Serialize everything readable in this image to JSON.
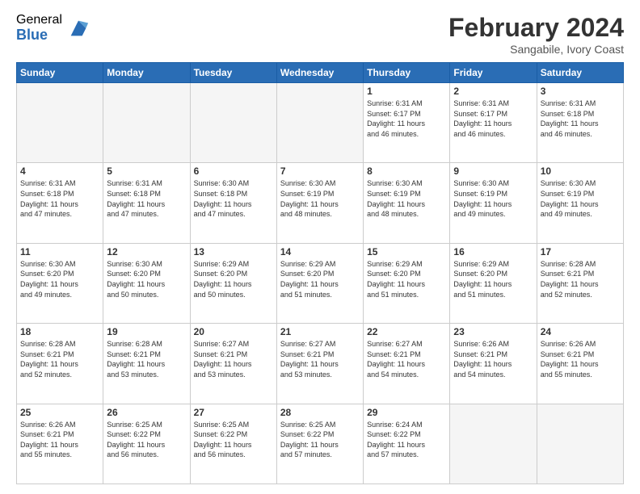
{
  "logo": {
    "general": "General",
    "blue": "Blue"
  },
  "title": {
    "month_year": "February 2024",
    "location": "Sangabile, Ivory Coast"
  },
  "days_of_week": [
    "Sunday",
    "Monday",
    "Tuesday",
    "Wednesday",
    "Thursday",
    "Friday",
    "Saturday"
  ],
  "weeks": [
    [
      {
        "day": "",
        "info": ""
      },
      {
        "day": "",
        "info": ""
      },
      {
        "day": "",
        "info": ""
      },
      {
        "day": "",
        "info": ""
      },
      {
        "day": "1",
        "info": "Sunrise: 6:31 AM\nSunset: 6:17 PM\nDaylight: 11 hours\nand 46 minutes."
      },
      {
        "day": "2",
        "info": "Sunrise: 6:31 AM\nSunset: 6:17 PM\nDaylight: 11 hours\nand 46 minutes."
      },
      {
        "day": "3",
        "info": "Sunrise: 6:31 AM\nSunset: 6:18 PM\nDaylight: 11 hours\nand 46 minutes."
      }
    ],
    [
      {
        "day": "4",
        "info": "Sunrise: 6:31 AM\nSunset: 6:18 PM\nDaylight: 11 hours\nand 47 minutes."
      },
      {
        "day": "5",
        "info": "Sunrise: 6:31 AM\nSunset: 6:18 PM\nDaylight: 11 hours\nand 47 minutes."
      },
      {
        "day": "6",
        "info": "Sunrise: 6:30 AM\nSunset: 6:18 PM\nDaylight: 11 hours\nand 47 minutes."
      },
      {
        "day": "7",
        "info": "Sunrise: 6:30 AM\nSunset: 6:19 PM\nDaylight: 11 hours\nand 48 minutes."
      },
      {
        "day": "8",
        "info": "Sunrise: 6:30 AM\nSunset: 6:19 PM\nDaylight: 11 hours\nand 48 minutes."
      },
      {
        "day": "9",
        "info": "Sunrise: 6:30 AM\nSunset: 6:19 PM\nDaylight: 11 hours\nand 49 minutes."
      },
      {
        "day": "10",
        "info": "Sunrise: 6:30 AM\nSunset: 6:19 PM\nDaylight: 11 hours\nand 49 minutes."
      }
    ],
    [
      {
        "day": "11",
        "info": "Sunrise: 6:30 AM\nSunset: 6:20 PM\nDaylight: 11 hours\nand 49 minutes."
      },
      {
        "day": "12",
        "info": "Sunrise: 6:30 AM\nSunset: 6:20 PM\nDaylight: 11 hours\nand 50 minutes."
      },
      {
        "day": "13",
        "info": "Sunrise: 6:29 AM\nSunset: 6:20 PM\nDaylight: 11 hours\nand 50 minutes."
      },
      {
        "day": "14",
        "info": "Sunrise: 6:29 AM\nSunset: 6:20 PM\nDaylight: 11 hours\nand 51 minutes."
      },
      {
        "day": "15",
        "info": "Sunrise: 6:29 AM\nSunset: 6:20 PM\nDaylight: 11 hours\nand 51 minutes."
      },
      {
        "day": "16",
        "info": "Sunrise: 6:29 AM\nSunset: 6:20 PM\nDaylight: 11 hours\nand 51 minutes."
      },
      {
        "day": "17",
        "info": "Sunrise: 6:28 AM\nSunset: 6:21 PM\nDaylight: 11 hours\nand 52 minutes."
      }
    ],
    [
      {
        "day": "18",
        "info": "Sunrise: 6:28 AM\nSunset: 6:21 PM\nDaylight: 11 hours\nand 52 minutes."
      },
      {
        "day": "19",
        "info": "Sunrise: 6:28 AM\nSunset: 6:21 PM\nDaylight: 11 hours\nand 53 minutes."
      },
      {
        "day": "20",
        "info": "Sunrise: 6:27 AM\nSunset: 6:21 PM\nDaylight: 11 hours\nand 53 minutes."
      },
      {
        "day": "21",
        "info": "Sunrise: 6:27 AM\nSunset: 6:21 PM\nDaylight: 11 hours\nand 53 minutes."
      },
      {
        "day": "22",
        "info": "Sunrise: 6:27 AM\nSunset: 6:21 PM\nDaylight: 11 hours\nand 54 minutes."
      },
      {
        "day": "23",
        "info": "Sunrise: 6:26 AM\nSunset: 6:21 PM\nDaylight: 11 hours\nand 54 minutes."
      },
      {
        "day": "24",
        "info": "Sunrise: 6:26 AM\nSunset: 6:21 PM\nDaylight: 11 hours\nand 55 minutes."
      }
    ],
    [
      {
        "day": "25",
        "info": "Sunrise: 6:26 AM\nSunset: 6:21 PM\nDaylight: 11 hours\nand 55 minutes."
      },
      {
        "day": "26",
        "info": "Sunrise: 6:25 AM\nSunset: 6:22 PM\nDaylight: 11 hours\nand 56 minutes."
      },
      {
        "day": "27",
        "info": "Sunrise: 6:25 AM\nSunset: 6:22 PM\nDaylight: 11 hours\nand 56 minutes."
      },
      {
        "day": "28",
        "info": "Sunrise: 6:25 AM\nSunset: 6:22 PM\nDaylight: 11 hours\nand 57 minutes."
      },
      {
        "day": "29",
        "info": "Sunrise: 6:24 AM\nSunset: 6:22 PM\nDaylight: 11 hours\nand 57 minutes."
      },
      {
        "day": "",
        "info": ""
      },
      {
        "day": "",
        "info": ""
      }
    ]
  ]
}
